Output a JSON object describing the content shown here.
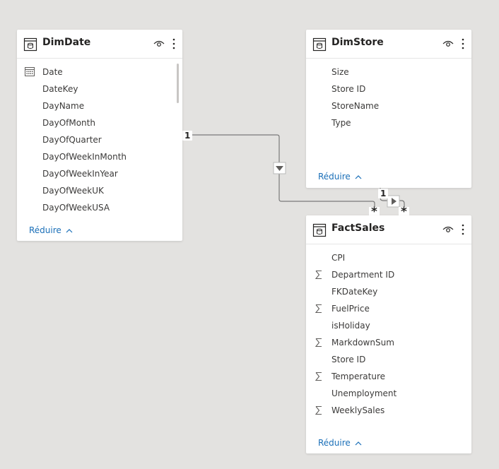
{
  "tables": {
    "dimdate": {
      "title": "DimDate",
      "fields": [
        "Date",
        "DateKey",
        "DayName",
        "DayOfMonth",
        "DayOfQuarter",
        "DayOfWeekInMonth",
        "DayOfWeekInYear",
        "DayOfWeekUK",
        "DayOfWeekUSA"
      ],
      "collapse_label": "Réduire"
    },
    "dimstore": {
      "title": "DimStore",
      "fields": [
        "Size",
        "Store ID",
        "StoreName",
        "Type"
      ],
      "collapse_label": "Réduire"
    },
    "factsales": {
      "title": "FactSales",
      "fields": [
        "CPI",
        "Department ID",
        "FKDateKey",
        "FuelPrice",
        "isHoliday",
        "MarkdownSum",
        "Store ID",
        "Temperature",
        "Unemployment",
        "WeeklySales"
      ],
      "summed_fields": [
        "Department ID",
        "FuelPrice",
        "MarkdownSum",
        "Temperature",
        "WeeklySales"
      ],
      "collapse_label": "Réduire"
    }
  },
  "relationships": [
    {
      "from": "DimDate",
      "to": "FactSales",
      "one_label": "1",
      "many_label": "*"
    },
    {
      "from": "DimStore",
      "to": "FactSales",
      "one_label": "1",
      "many_label": "*"
    }
  ],
  "colors": {
    "canvas": "#e3e2e0",
    "card": "#ffffff",
    "link": "#1a6fb8",
    "line": "#7a7a7a"
  },
  "icons": {
    "table_header": "table-icon",
    "visibility": "eye-icon",
    "more": "more-options-icon",
    "date_field": "calendar-icon",
    "sum_field": "sigma-icon",
    "filter_direction": "triangle-down-icon"
  }
}
